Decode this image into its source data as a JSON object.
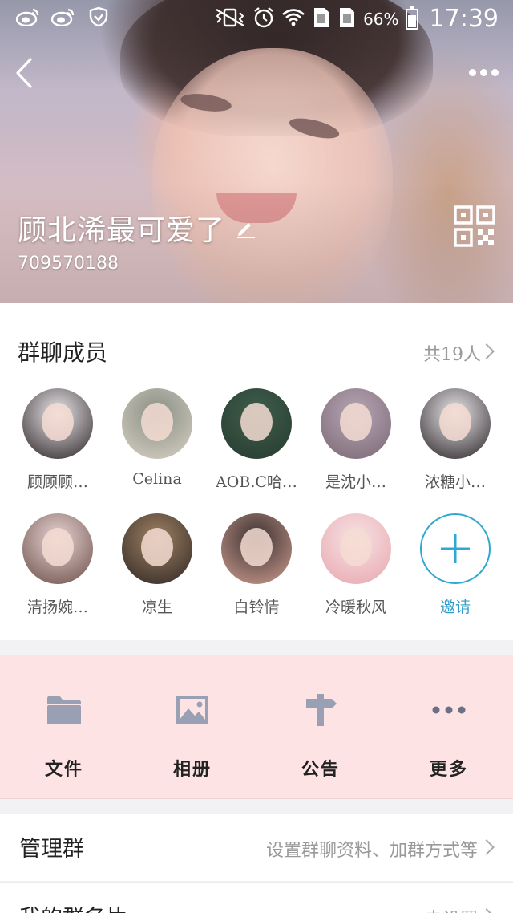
{
  "status_bar": {
    "left_icons": [
      "weibo-icon",
      "weibo-icon",
      "shield-icon"
    ],
    "right_icons": [
      "vibrate-icon",
      "alarm-icon",
      "wifi-icon",
      "sim-card-icon",
      "sim-card-icon"
    ],
    "battery_percent": "66%",
    "battery_level": 0.66,
    "time": "17:39"
  },
  "header": {
    "back_icon": "chevron-left-icon",
    "more_icon": "more-horizontal-icon",
    "group_name": "顾北浠最可爱了",
    "group_id": "709570188",
    "edit_icon": "pencil-icon",
    "qr_icon": "qr-code-icon"
  },
  "members": {
    "title": "群聊成员",
    "count_label": "共19人",
    "list": [
      {
        "name": "顾顾顾…",
        "colors": [
          "#e9e5ea",
          "#2b2424"
        ]
      },
      {
        "name": "Celina",
        "colors": [
          "#8a8f86",
          "#d7d0c3"
        ]
      },
      {
        "name": "AOB.C哈…",
        "colors": [
          "#3f5e4b",
          "#263a30"
        ]
      },
      {
        "name": "是沈小…",
        "colors": [
          "#b6a6b4",
          "#7b6774"
        ]
      },
      {
        "name": "浓糖小…",
        "colors": [
          "#e8e6ea",
          "#2a2326"
        ]
      },
      {
        "name": "清扬婉…",
        "colors": [
          "#e7d4d4",
          "#6b4d47"
        ]
      },
      {
        "name": "凉生",
        "colors": [
          "#9f8162",
          "#2e2624"
        ]
      },
      {
        "name": "白铃情",
        "colors": [
          "#3b3232",
          "#ce9c8f"
        ]
      },
      {
        "name": "冷暖秋风",
        "colors": [
          "#f6e2e4",
          "#e8a6ae"
        ]
      }
    ],
    "invite_label": "邀请",
    "invite_icon": "plus-icon"
  },
  "actions": [
    {
      "label": "文件",
      "icon": "folder-icon"
    },
    {
      "label": "相册",
      "icon": "image-icon"
    },
    {
      "label": "公告",
      "icon": "signpost-icon"
    },
    {
      "label": "更多",
      "icon": "more-horizontal-icon"
    }
  ],
  "rows": [
    {
      "label": "管理群",
      "value": "设置群聊资料、加群方式等"
    },
    {
      "label": "我的群名片",
      "value": "未设置"
    }
  ],
  "colors": {
    "accent": "#2fa9cf",
    "action_bar_bg": "#fde3e4",
    "action_icon": "#9aa0b4"
  }
}
